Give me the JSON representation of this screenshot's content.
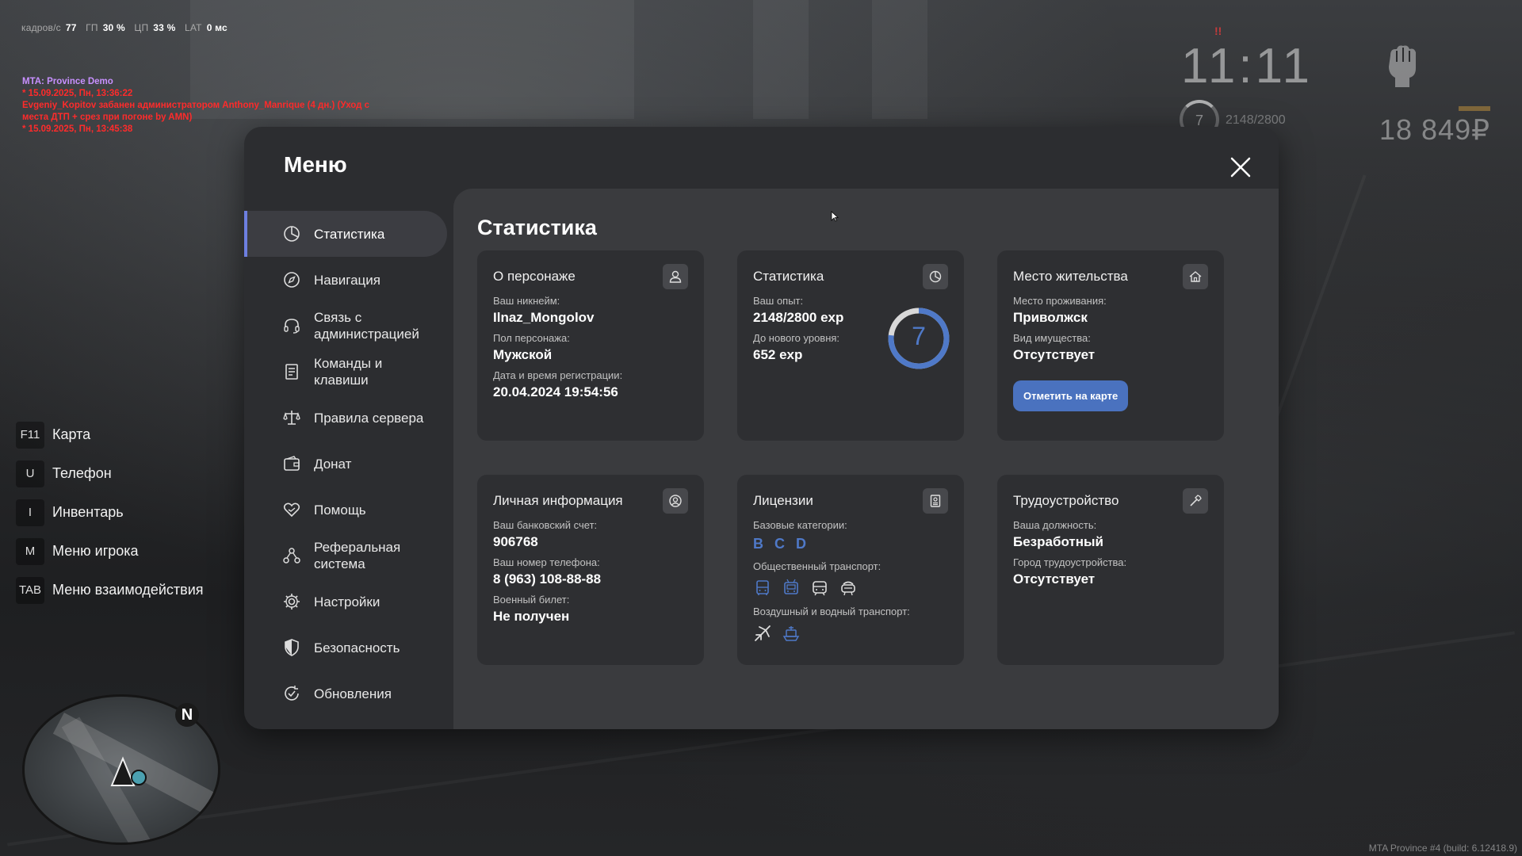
{
  "hud": {
    "fps_label": "кадров/с",
    "fps_value": "77",
    "gpu_label": "ГП",
    "gpu_value": "30 %",
    "cpu_label": "ЦП",
    "cpu_value": "33 %",
    "lat_label": "LAT",
    "lat_value": "0 мс",
    "clock": "11:11",
    "alert_mark": "!!",
    "level": "7",
    "exp": "2148/2800",
    "money": "18 849₽",
    "build": "MTA Province #4 (build: 6.12418.9)"
  },
  "chat": {
    "title": "MTA: Province Demo",
    "line1": "* 15.09.2025, Пн, 13:36:22",
    "line2": "Evgeniy_Kopitov забанен администратором Anthony_Manrique (4 дн.) (Уход с места ДТП + срез при погоне by AMN)",
    "line3": "* 15.09.2025, Пн, 13:45:38"
  },
  "hotkeys": [
    {
      "key": "F11",
      "label": "Карта"
    },
    {
      "key": "U",
      "label": "Телефон"
    },
    {
      "key": "I",
      "label": "Инвентарь"
    },
    {
      "key": "M",
      "label": "Меню игрока"
    },
    {
      "key": "TAB",
      "label": "Меню взаимодействия"
    }
  ],
  "minimap": {
    "north": "N"
  },
  "menu": {
    "title": "Меню",
    "nav": [
      {
        "label": "Статистика",
        "icon": "pie-chart-icon",
        "active": true
      },
      {
        "label": "Навигация",
        "icon": "compass-icon"
      },
      {
        "label": "Связь с\nадминистрацией",
        "icon": "headset-icon"
      },
      {
        "label": "Команды и\nклавиши",
        "icon": "document-icon"
      },
      {
        "label": "Правила сервера",
        "icon": "scales-icon"
      },
      {
        "label": "Донат",
        "icon": "wallet-icon"
      },
      {
        "label": "Помощь",
        "icon": "heart-hand-icon"
      },
      {
        "label": "Реферальная\nсистема",
        "icon": "referral-icon"
      },
      {
        "label": "Настройки",
        "icon": "gear-icon"
      },
      {
        "label": "Безопасность",
        "icon": "shield-icon"
      },
      {
        "label": "Обновления",
        "icon": "refresh-check-icon"
      }
    ],
    "content_title": "Статистика",
    "character": {
      "title": "О персонаже",
      "nick_label": "Ваш никнейм:",
      "nick": "Ilnaz_Mongolov",
      "gender_label": "Пол персонажа:",
      "gender": "Мужской",
      "reg_label": "Дата и время регистрации:",
      "reg": "20.04.2024 19:54:56"
    },
    "stats": {
      "title": "Статистика",
      "exp_label": "Ваш опыт:",
      "exp": "2148/2800 exp",
      "next_label": "До нового уровня:",
      "next": "652 exp",
      "level": "7",
      "progress": 0.767
    },
    "residence": {
      "title": "Место жительства",
      "place_label": "Место проживания:",
      "place": "Приволжск",
      "property_label": "Вид имущества:",
      "property": "Отсутствует",
      "button": "Отметить на карте"
    },
    "personal": {
      "title": "Личная информация",
      "bank_label": "Ваш банковский счет:",
      "bank": "906768",
      "phone_label": "Ваш номер телефона:",
      "phone": "8 (963) 108-88-88",
      "military_label": "Военный билет:",
      "military": "Не получен"
    },
    "licenses": {
      "title": "Лицензии",
      "base_label": "Базовые категории:",
      "categories": [
        "B",
        "C",
        "D"
      ],
      "public_label": "Общественный транспорт:",
      "air_label": "Воздушный и водный транспорт:"
    },
    "job": {
      "title": "Трудоустройство",
      "position_label": "Ваша должность:",
      "position": "Безработный",
      "city_label": "Город трудоустройства:",
      "city": "Отсутствует"
    }
  },
  "colors": {
    "accent_blue": "#4f79c8",
    "button_blue": "#4a72bf",
    "chat_red": "#ff2b2b",
    "chat_title": "#c890ff"
  }
}
